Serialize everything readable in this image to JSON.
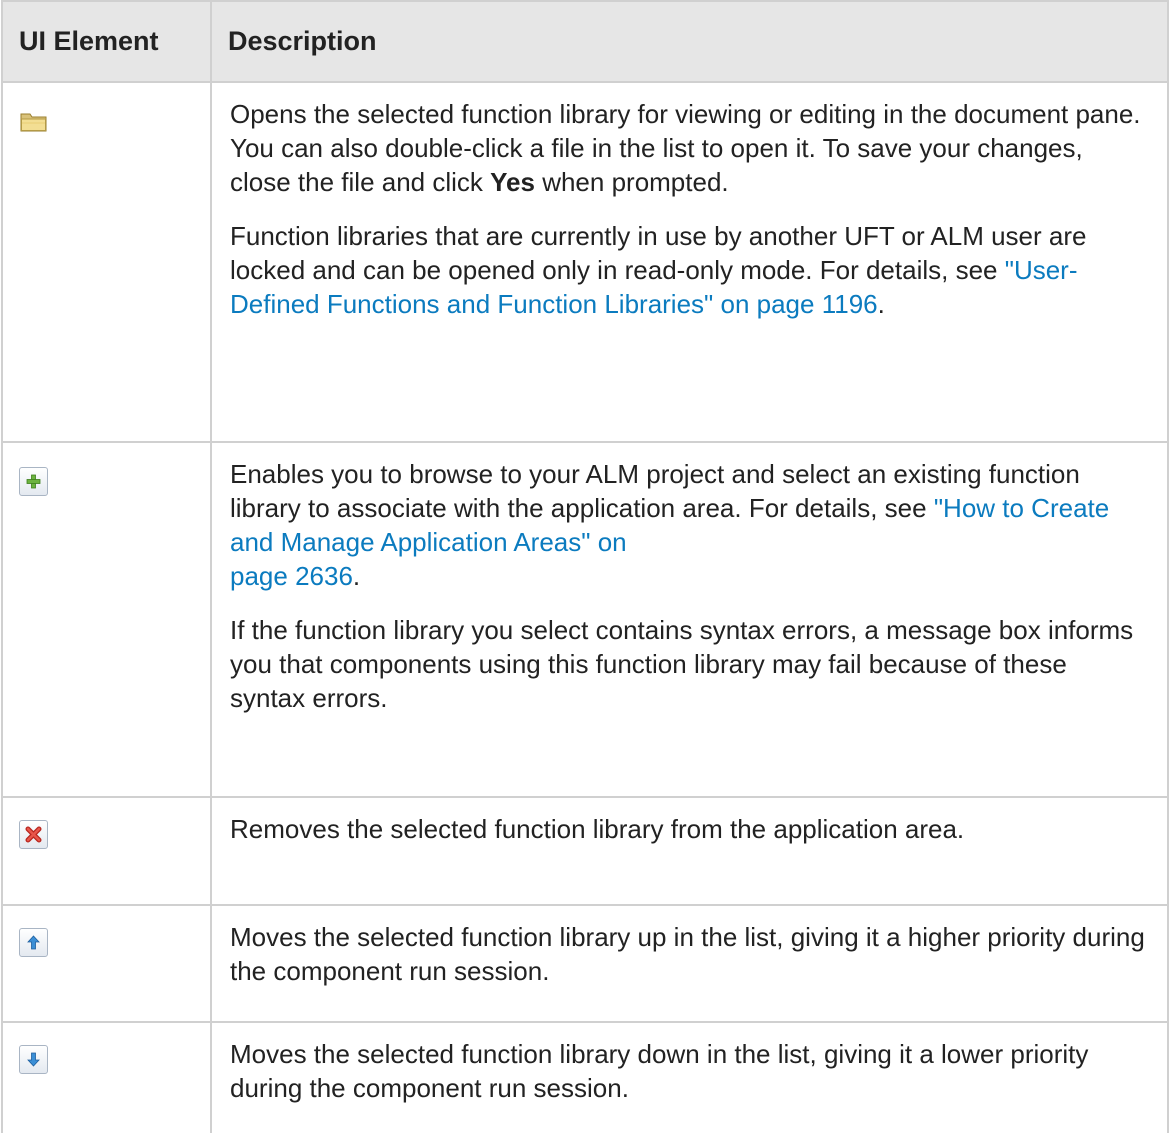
{
  "table": {
    "headers": {
      "ui_element": "UI Element",
      "description": "Description"
    },
    "rows": [
      {
        "icon": "open-folder-icon",
        "paragraphs": [
          {
            "t1": "Opens the selected function library for viewing or editing in the document pane. You can also double-click a file in the list to open it. To save your changes, close the file and click ",
            "bold": "Yes",
            "t2": " when prompted."
          },
          {
            "t1": "Function libraries that are currently in use by another UFT or ALM user are locked and can be opened only in read-only mode. For details, see ",
            "link": "\"User-Defined Functions and Function Libraries\" on page 1196",
            "t2": "."
          }
        ]
      },
      {
        "icon": "add-icon",
        "paragraphs": [
          {
            "t1": "Enables you to browse to your ALM project and select an existing function library to associate with the application area. For details, see ",
            "link1": "\"How to Create and Manage Application Areas\" on",
            "link2": "page 2636",
            "t2": "."
          },
          {
            "t1": "If the function library you select contains syntax errors, a message box informs you that components using this function library may fail because of these syntax errors."
          }
        ]
      },
      {
        "icon": "remove-icon",
        "paragraphs": [
          {
            "t1": "Removes the selected function library from the application area."
          }
        ]
      },
      {
        "icon": "move-up-icon",
        "paragraphs": [
          {
            "t1": "Moves the selected function library up in the list, giving it a higher priority during the component run session."
          }
        ]
      },
      {
        "icon": "move-down-icon",
        "paragraphs": [
          {
            "t1": "Moves the selected function library down in the list, giving it a lower priority during the component run session."
          }
        ]
      }
    ]
  },
  "colors": {
    "link": "#0b7bbf",
    "header_bg": "#e6e6e6",
    "border": "#d0d0d0"
  }
}
